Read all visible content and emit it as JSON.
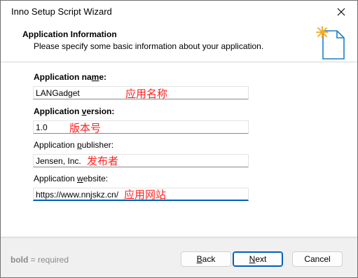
{
  "window": {
    "title": "Inno Setup Script Wizard"
  },
  "header": {
    "title": "Application Information",
    "subtitle": "Please specify some basic information about your application.",
    "icon": "wizard-document-icon"
  },
  "fields": [
    {
      "label_pre": "Application na",
      "label_accel": "m",
      "label_post": "e:",
      "required": true,
      "value": "LANGadget",
      "annotation": "应用名称"
    },
    {
      "label_pre": "Application ",
      "label_accel": "v",
      "label_post": "ersion:",
      "required": true,
      "value": "1.0",
      "annotation": "版本号"
    },
    {
      "label_pre": "Application ",
      "label_accel": "p",
      "label_post": "ublisher:",
      "required": false,
      "value": "Jensen, Inc.",
      "annotation": "发布者"
    },
    {
      "label_pre": "Application ",
      "label_accel": "w",
      "label_post": "ebsite:",
      "required": false,
      "value": "https://www.nnjskz.cn/",
      "annotation": "应用网站"
    }
  ],
  "footer": {
    "note_bold": "bold",
    "note_rest": " = required",
    "back": {
      "accel": "B",
      "rest": "ack"
    },
    "next": {
      "accel": "N",
      "rest": "ext"
    },
    "cancel": "Cancel"
  },
  "colors": {
    "accent": "#005fb8",
    "annotation": "#ff2020",
    "icon_star": "#f5a623",
    "icon_doc": "#1d7fc4"
  }
}
